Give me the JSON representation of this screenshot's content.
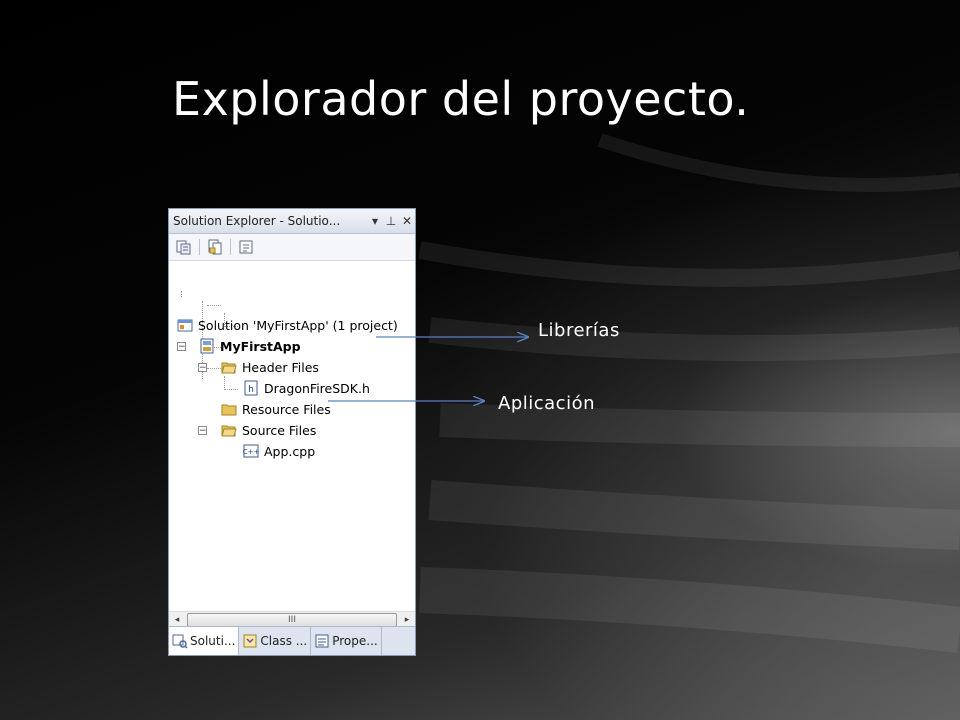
{
  "slide": {
    "title": "Explorador del proyecto."
  },
  "panel": {
    "header_title": "Solution Explorer - Solutio...",
    "header_buttons": {
      "dropdown": "▾",
      "pin": "⊥",
      "close": "✕"
    },
    "toolbar_icons": [
      "properties-icon",
      "show-all-files-icon",
      "view-code-icon"
    ],
    "tree": {
      "solution": "Solution 'MyFirstApp' (1 project)",
      "project": "MyFirstApp",
      "header_files": "Header Files",
      "header_file": "DragonFireSDK.h",
      "resource_files": "Resource Files",
      "source_files": "Source Files",
      "source_file": "App.cpp"
    },
    "scrollbar": {
      "left": "◂",
      "thumb": "III",
      "right": "▸"
    },
    "tabs": [
      {
        "label": "Soluti...",
        "active": true
      },
      {
        "label": "Class ...",
        "active": false
      },
      {
        "label": "Prope...",
        "active": false
      }
    ]
  },
  "annotations": {
    "librerias": "Librerías",
    "aplicacion": "Aplicación"
  },
  "colors": {
    "arrow": "#5b7fbf",
    "folder": "#e9c35a",
    "panel_border": "#8a9bb5"
  }
}
